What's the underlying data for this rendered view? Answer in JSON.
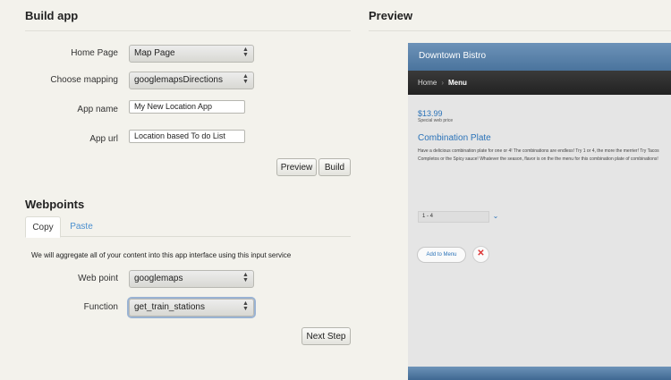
{
  "build": {
    "title": "Build app",
    "fields": [
      {
        "label": "Home Page",
        "value": "Map Page"
      },
      {
        "label": "Choose mapping",
        "value": "googlemapsDirections"
      },
      {
        "label": "App name",
        "value": "My New Location App"
      },
      {
        "label": "App url",
        "value": "Location based To do List"
      }
    ],
    "preview_label": "Preview",
    "build_label": "Build"
  },
  "webpoints": {
    "title": "Webpoints",
    "tabs": [
      {
        "label": "Copy"
      },
      {
        "label": "Paste"
      }
    ],
    "description": "We will aggregate all of your content into this app interface using this input service",
    "fields": [
      {
        "label": "Web point",
        "value": "googlemaps"
      },
      {
        "label": "Function",
        "value": "get_train_stations"
      }
    ],
    "next_label": "Next Step"
  },
  "preview": {
    "title": "Preview",
    "app_title": "Downtown Bistro",
    "nav_home": "Home",
    "nav_separator": "›",
    "nav_current": "Menu",
    "price": "$13.99",
    "price_note": "Special web price",
    "item_title": "Combination Plate",
    "item_desc": "Have a delicious combination plate for one or 4! The combinations are endless! Try 1 or 4, the more the merrier! Try Tacos Completos or the Spicy sauce! Whatever the season, flavor is on the the menu for this combination plate of combinations!",
    "qty_value": "1 - 4",
    "add_label": "Add to Menu",
    "remove_symbol": "✕"
  }
}
